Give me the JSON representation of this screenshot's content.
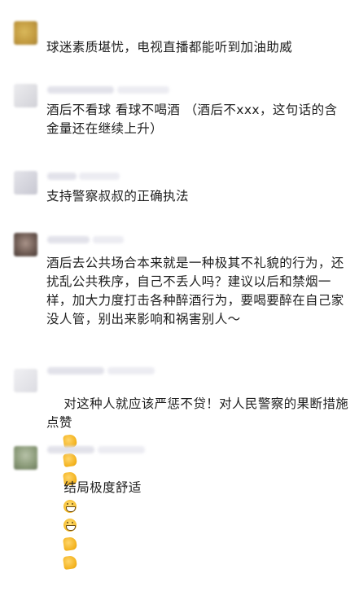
{
  "comments": [
    {
      "text": "球迷素质堪忧，电视直播都能听到加油助威",
      "avatar_color": "#c7a349",
      "emoji": []
    },
    {
      "text": "酒后不看球 看球不喝酒 （酒后不xxx，这句话的含金量还在继续上升）",
      "avatar_color": "#d9d9dd",
      "emoji": []
    },
    {
      "text": "支持警察叔叔的正确执法",
      "avatar_color": "#cfcfd6",
      "emoji": []
    },
    {
      "text": "酒后去公共场合本来就是一种极其不礼貌的行为，还扰乱公共秩序，自己不丢人吗？建议以后和禁烟一样，加大力度打击各种醉酒行为，要喝要醉在自己家没人管，别出来影响和祸害别人～",
      "avatar_color": "#6d5a52",
      "emoji": []
    },
    {
      "text": "对这种人就应该严惩不贷！对人民警察的果断措施点赞",
      "avatar_color": "#e3e3e8",
      "emoji": [
        "thumbs-up",
        "thumbs-up",
        "thumbs-up"
      ]
    },
    {
      "text": "结局极度舒适",
      "avatar_color": "#8a9a78",
      "emoji": [
        "grinning-face",
        "grinning-face",
        "thumbs-up",
        "thumbs-up"
      ]
    }
  ]
}
